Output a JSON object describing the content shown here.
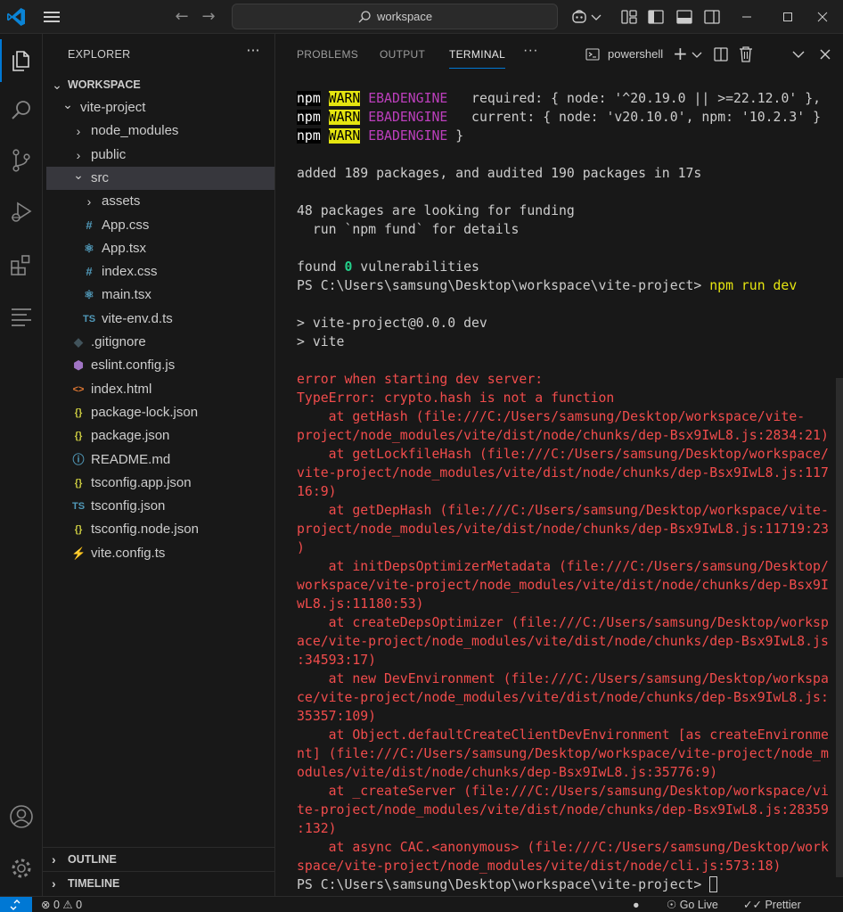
{
  "titlebar": {
    "search_text": "workspace"
  },
  "sidebar": {
    "header": "EXPLORER",
    "more": "···",
    "workspace_label": "WORKSPACE",
    "tree": [
      {
        "label": "vite-project",
        "kind": "folder-open",
        "depth": 1,
        "icon": ""
      },
      {
        "label": "node_modules",
        "kind": "folder",
        "depth": 2,
        "icon": ""
      },
      {
        "label": "public",
        "kind": "folder",
        "depth": 2,
        "icon": ""
      },
      {
        "label": "src",
        "kind": "folder-open",
        "depth": 2,
        "icon": "",
        "selected": true
      },
      {
        "label": "assets",
        "kind": "folder",
        "depth": 3,
        "icon": ""
      },
      {
        "label": "App.css",
        "kind": "file",
        "depth": 3,
        "icon": "#"
      },
      {
        "label": "App.tsx",
        "kind": "file",
        "depth": 3,
        "icon": "react"
      },
      {
        "label": "index.css",
        "kind": "file",
        "depth": 3,
        "icon": "#"
      },
      {
        "label": "main.tsx",
        "kind": "file",
        "depth": 3,
        "icon": "react"
      },
      {
        "label": "vite-env.d.ts",
        "kind": "file",
        "depth": 3,
        "icon": "TS"
      },
      {
        "label": ".gitignore",
        "kind": "file",
        "depth": 2,
        "icon": "git"
      },
      {
        "label": "eslint.config.js",
        "kind": "file",
        "depth": 2,
        "icon": "eslint"
      },
      {
        "label": "index.html",
        "kind": "file",
        "depth": 2,
        "icon": "html"
      },
      {
        "label": "package-lock.json",
        "kind": "file",
        "depth": 2,
        "icon": "{}"
      },
      {
        "label": "package.json",
        "kind": "file",
        "depth": 2,
        "icon": "{}"
      },
      {
        "label": "README.md",
        "kind": "file",
        "depth": 2,
        "icon": "info"
      },
      {
        "label": "tsconfig.app.json",
        "kind": "file",
        "depth": 2,
        "icon": "{}"
      },
      {
        "label": "tsconfig.json",
        "kind": "file",
        "depth": 2,
        "icon": "tsconfig"
      },
      {
        "label": "tsconfig.node.json",
        "kind": "file",
        "depth": 2,
        "icon": "{}"
      },
      {
        "label": "vite.config.ts",
        "kind": "file",
        "depth": 2,
        "icon": "vite"
      }
    ],
    "outline_label": "OUTLINE",
    "timeline_label": "TIMELINE"
  },
  "panel": {
    "tabs": [
      "PROBLEMS",
      "OUTPUT",
      "TERMINAL"
    ],
    "active_tab": "TERMINAL",
    "more": "···",
    "shell_label": "powershell"
  },
  "terminal": {
    "warn_lines": [
      {
        "npm": "npm",
        "warn": "WARN",
        "code": "EBADENGINE",
        "rest": "   required: { node: '^20.19.0 || >=22.12.0' },"
      },
      {
        "npm": "npm",
        "warn": "WARN",
        "code": "EBADENGINE",
        "rest": "   current: { node: 'v20.10.0', npm: '10.2.3' }"
      },
      {
        "npm": "npm",
        "warn": "WARN",
        "code": "EBADENGINE",
        "rest": " }"
      }
    ],
    "added_line": "added 189 packages, and audited 190 packages in 17s",
    "funding_line1": "48 packages are looking for funding",
    "funding_line2": "  run `npm fund` for details",
    "found_prefix": "found ",
    "found_count": "0",
    "found_suffix": " vulnerabilities",
    "prompt": "PS C:\\Users\\samsung\\Desktop\\workspace\\vite-project> ",
    "command": "npm run dev",
    "run_line1": "> vite-project@0.0.0 dev",
    "run_line2": "> vite",
    "error_lines": [
      "error when starting dev server:",
      "TypeError: crypto.hash is not a function",
      "    at getHash (file:///C:/Users/samsung/Desktop/workspace/vite-",
      "project/node_modules/vite/dist/node/chunks/dep-Bsx9IwL8.js:2834:21)",
      "    at getLockfileHash (file:///C:/Users/samsung/Desktop/workspace/",
      "vite-project/node_modules/vite/dist/node/chunks/dep-Bsx9IwL8.js:117",
      "16:9)",
      "    at getDepHash (file:///C:/Users/samsung/Desktop/workspace/vite-",
      "project/node_modules/vite/dist/node/chunks/dep-Bsx9IwL8.js:11719:23",
      ")",
      "    at initDepsOptimizerMetadata (file:///C:/Users/samsung/Desktop/",
      "workspace/vite-project/node_modules/vite/dist/node/chunks/dep-Bsx9I",
      "wL8.js:11180:53)",
      "    at createDepsOptimizer (file:///C:/Users/samsung/Desktop/worksp",
      "ace/vite-project/node_modules/vite/dist/node/chunks/dep-Bsx9IwL8.js",
      ":34593:17)",
      "    at new DevEnvironment (file:///C:/Users/samsung/Desktop/workspa",
      "ce/vite-project/node_modules/vite/dist/node/chunks/dep-Bsx9IwL8.js:",
      "35357:109)",
      "    at Object.defaultCreateClientDevEnvironment [as createEnvironme",
      "nt] (file:///C:/Users/samsung/Desktop/workspace/vite-project/node_m",
      "odules/vite/dist/node/chunks/dep-Bsx9IwL8.js:35776:9)",
      "    at _createServer (file:///C:/Users/samsung/Desktop/workspace/vi",
      "te-project/node_modules/vite/dist/node/chunks/dep-Bsx9IwL8.js:28359",
      ":132)",
      "    at async CAC.<anonymous> (file:///C:/Users/samsung/Desktop/work",
      "space/vite-project/node_modules/vite/dist/node/cli.js:573:18)"
    ],
    "final_prompt": "PS C:\\Users\\samsung\\Desktop\\workspace\\vite-project> "
  },
  "statusbar": {
    "errors": "0",
    "warnings": "0",
    "golive": "Go Live",
    "prettier": "Prettier"
  },
  "colors": {
    "accent": "#0078d4",
    "error_text": "#f14c4c",
    "warn_bg": "#e5e510",
    "ebadengine": "#bc3fbc",
    "vuln_count": "#23d18b",
    "command": "#e5e510"
  }
}
